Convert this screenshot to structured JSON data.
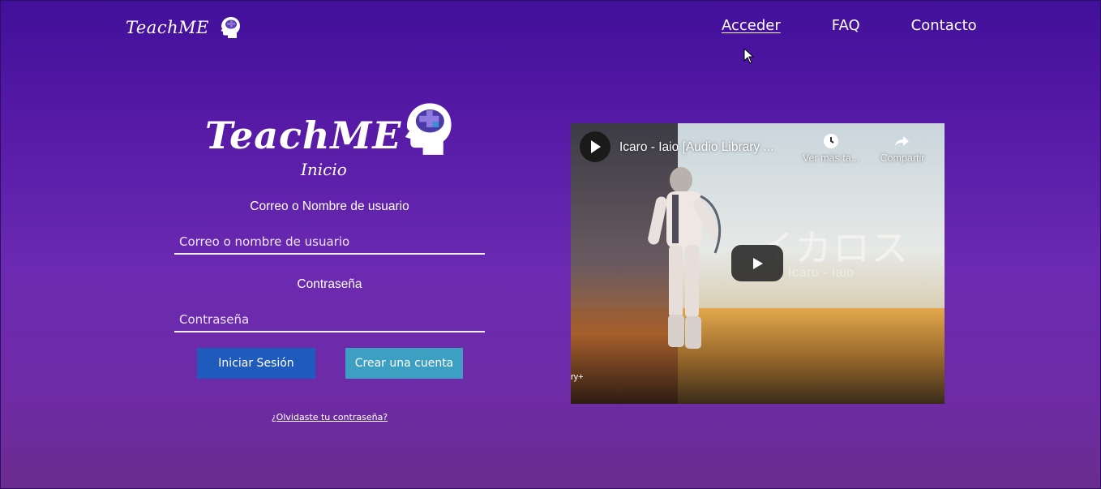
{
  "header": {
    "brand": "TeachME",
    "nav": [
      {
        "label": "Acceder",
        "active": true
      },
      {
        "label": "FAQ",
        "active": false
      },
      {
        "label": "Contacto",
        "active": false
      }
    ]
  },
  "login": {
    "logo_text": "TeachME",
    "logo_subtitle": "Inicio",
    "user_label": "Correo o Nombre de usuario",
    "user_placeholder": "Correo o nombre de usuario",
    "password_label": "Contraseña",
    "password_placeholder": "Contraseña",
    "login_button": "Iniciar Sesión",
    "create_button": "Crear una cuenta",
    "forgot_link": "¿Olvidaste tu contraseña?"
  },
  "video": {
    "title": "Icaro - Iaio [Audio Library ...",
    "watch_later": "Ver más ta...",
    "share": "Compartir",
    "overlay_title": "イカロス",
    "overlay_subtitle": "Icaro - Iaio",
    "watermark": "ry+"
  },
  "colors": {
    "login_button": "#1f5bbd",
    "create_button": "#3d9fc2",
    "background_top": "#41109a",
    "background_bottom": "#6a2c8f"
  }
}
